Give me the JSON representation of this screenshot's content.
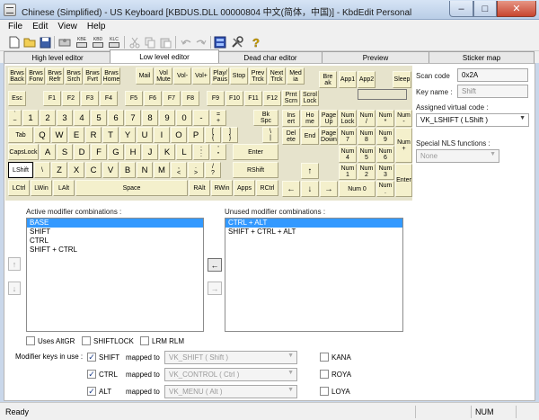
{
  "window": {
    "title": "Chinese (Simplified) - US Keyboard [KBDUS.DLL 00000804 中文(简体，中国)] - KbdEdit Personal",
    "min_symbol": "–",
    "max_symbol": "□",
    "close_symbol": "✕"
  },
  "menu": [
    "File",
    "Edit",
    "View",
    "Help"
  ],
  "toolbar": {
    "icons": [
      "new-file-icon",
      "open-folder-icon",
      "save-icon",
      "keyboard-load-icon",
      "kbe-import-icon",
      "kbd-import-icon",
      "klc-import-icon",
      "cut-icon",
      "copy-icon",
      "paste-icon",
      "undo-icon",
      "redo-icon",
      "ime-icon",
      "tools-icon",
      "help-icon"
    ],
    "kbe_label": "KBE",
    "kbd_label": "KBD",
    "klc_label": "KLC"
  },
  "tabs": [
    "High level editor",
    "Low level editor",
    "Dead char editor",
    "Preview",
    "Sticker map"
  ],
  "keys": {
    "row0": [
      "Brws\nBack",
      "Brws\nForw",
      "Brws\nRefr",
      "Brws\nSrch",
      "Brws\nFvrt",
      "Brws\nHome",
      "Mail",
      "Vol\nMute",
      "Vol-",
      "Vol+",
      "Play/\nPaus",
      "Stop",
      "Prev\nTrck",
      "Next\nTrck",
      "Med\nia",
      "Bre\nak",
      "App1",
      "App2",
      "Sleep"
    ],
    "esc": "Esc",
    "fkeys": [
      "F1",
      "F2",
      "F3",
      "F4",
      "F5",
      "F6",
      "F7",
      "F8",
      "F9",
      "F10",
      "F11",
      "F12"
    ],
    "nav_top": [
      "Prnt\nScrn",
      "Scrol\nLock"
    ],
    "row1": [
      "`\n~",
      "1",
      "2",
      "3",
      "4",
      "5",
      "6",
      "7",
      "8",
      "9",
      "0",
      "-",
      "=\n+",
      "Bk\nSpc"
    ],
    "row2": [
      "Tab",
      "Q",
      "W",
      "E",
      "R",
      "T",
      "Y",
      "U",
      "I",
      "O",
      "P",
      "[\n{",
      "]\n}",
      "\\\n|"
    ],
    "row3": [
      "CapsLock",
      "A",
      "S",
      "D",
      "F",
      "G",
      "H",
      "J",
      "K",
      "L",
      ";\n:",
      "'\n\"",
      "Enter"
    ],
    "row4": [
      "LShift",
      "\\",
      "Z",
      "X",
      "C",
      "V",
      "B",
      "N",
      "M",
      ",\n<",
      ".\n>",
      "/\n?",
      "RShift"
    ],
    "row5": [
      "LCtrl",
      "LWin",
      "LAlt",
      "Space",
      "RAlt",
      "RWin",
      "Apps",
      "RCtrl"
    ],
    "nav": [
      "Ins\nert",
      "Ho\nme",
      "Page\nUp",
      "Del\nete",
      "End",
      "Page\nDown"
    ],
    "arrows": [
      "↑",
      "←",
      "↓",
      "→"
    ],
    "numpad": [
      "Num\nLock",
      "Num\n/",
      "Num\n*",
      "Num\n-",
      "Num\n7",
      "Num\n8",
      "Num\n9",
      "Num\n+",
      "Num\n4",
      "Num\n5",
      "Num\n6",
      "Num\n1",
      "Num\n2",
      "Num\n3",
      "Enter",
      "Num 0",
      "Num\n."
    ]
  },
  "details": {
    "scan_code_label": "Scan code",
    "scan_code_value": "0x2A",
    "key_name_label": "Key name :",
    "key_name_value": "Shift",
    "vk_label": "Assigned virtual code :",
    "vk_value": "VK_LSHIFT ( LShift )",
    "nls_label": "Special NLS functions :",
    "nls_value": "None"
  },
  "modifiers": {
    "active_label": "Active modifier combinations :",
    "active": [
      "BASE",
      "SHIFT",
      "CTRL",
      "SHIFT + CTRL"
    ],
    "unused_label": "Unused modifier combinations :",
    "unused": [
      "CTRL + ALT",
      "SHIFT + CTRL + ALT"
    ],
    "up_arrow": "↑",
    "down_arrow": "↓",
    "move_left": "←",
    "move_right": "→"
  },
  "options": {
    "uses_altgr": "Uses AltGR",
    "shiftlock": "SHIFTLOCK",
    "lrm_rlm": "LRM RLM",
    "keys_in_use_label": "Modifier keys in use :",
    "mapped_to": "mapped to",
    "shift": "SHIFT",
    "shift_vk": "VK_SHIFT ( Shift )",
    "ctrl": "CTRL",
    "ctrl_vk": "VK_CONTROL ( Ctrl )",
    "alt": "ALT",
    "alt_vk": "VK_MENU ( Alt )",
    "kana": "KANA",
    "roya": "ROYA",
    "loya": "LOYA",
    "check": "✓"
  },
  "status": {
    "text": "Ready",
    "num": "NUM"
  }
}
